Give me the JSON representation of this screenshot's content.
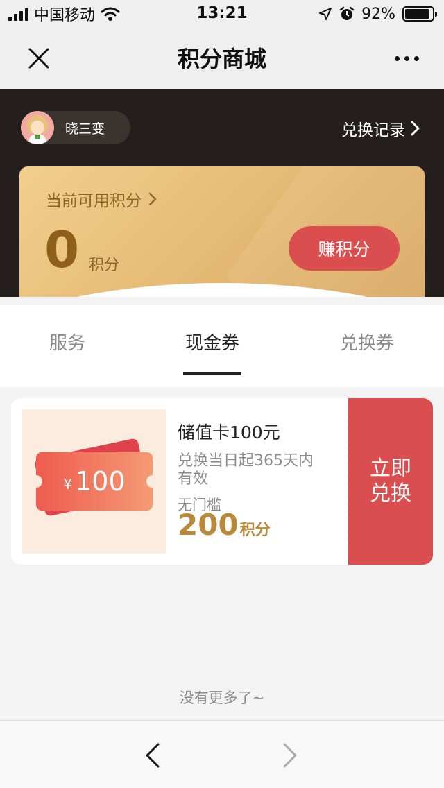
{
  "status_bar": {
    "carrier": "中国移动",
    "time": "13:21",
    "battery_pct": "92%",
    "battery_level": 0.92,
    "icons": [
      "signal-icon",
      "wifi-icon",
      "location-arrow-icon",
      "alarm-icon",
      "battery-icon"
    ]
  },
  "nav": {
    "title": "积分商城",
    "close_icon": "close-icon",
    "more_icon": "more-icon"
  },
  "header": {
    "username": "晓三变",
    "records_label": "兑换记录",
    "points_label": "当前可用积分",
    "points_value": "0",
    "points_unit": "积分",
    "earn_label": "赚积分"
  },
  "tabs": [
    {
      "label": "服务",
      "active": false
    },
    {
      "label": "现金券",
      "active": true
    },
    {
      "label": "兑换券",
      "active": false
    }
  ],
  "coupon": {
    "image_currency": "¥",
    "image_amount": "100",
    "title": "储值卡100元",
    "desc": "兑换当日起365天内有效",
    "threshold": "无门槛",
    "price": "200",
    "price_unit": "积分",
    "redeem_label": "立即兑换"
  },
  "footer": {
    "no_more": "没有更多了~"
  },
  "colors": {
    "accent_red": "#db4e4f",
    "gold_text": "#b88a3a",
    "header_bg": "#241e1c"
  }
}
